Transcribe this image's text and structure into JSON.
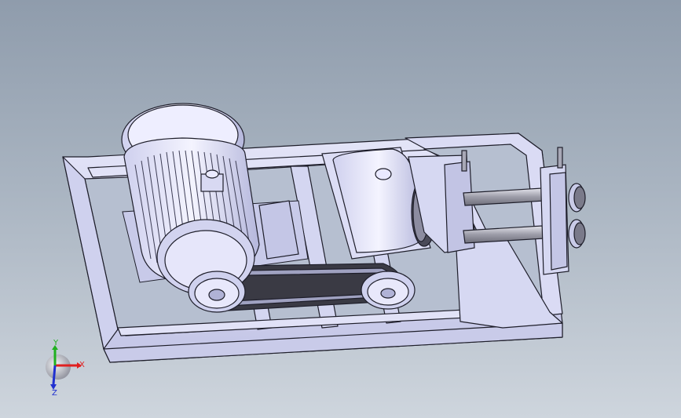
{
  "viewport": {
    "background_top": "#8f9cac",
    "background_bottom": "#ced5dd"
  },
  "model": {
    "part_color": "#d8d9f2",
    "part_shade": "#b9bbe0",
    "edge_color": "#1e1e2a",
    "shaft_color": "#9a9aa6",
    "belt_color": "#3a3a44"
  },
  "triad": {
    "x_label": "X",
    "y_label": "Y",
    "z_label": "Z",
    "x_color": "#e02020",
    "y_color": "#20b020",
    "z_color": "#2030d0"
  }
}
